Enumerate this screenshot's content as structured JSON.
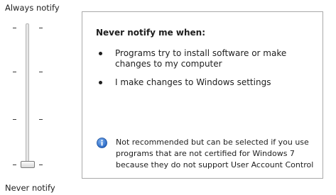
{
  "slider": {
    "top_label": "Always notify",
    "bottom_label": "Never notify",
    "level_index": 0,
    "level_count": 4
  },
  "panel": {
    "heading": "Never notify me when:",
    "bullets": [
      "Programs try to install software or make changes to my computer",
      "I make changes to Windows settings"
    ],
    "note": "Not recommended but can be selected if you use programs that are not certified for Windows 7 because they do not support User Account Control",
    "note_icon": "info-icon"
  }
}
